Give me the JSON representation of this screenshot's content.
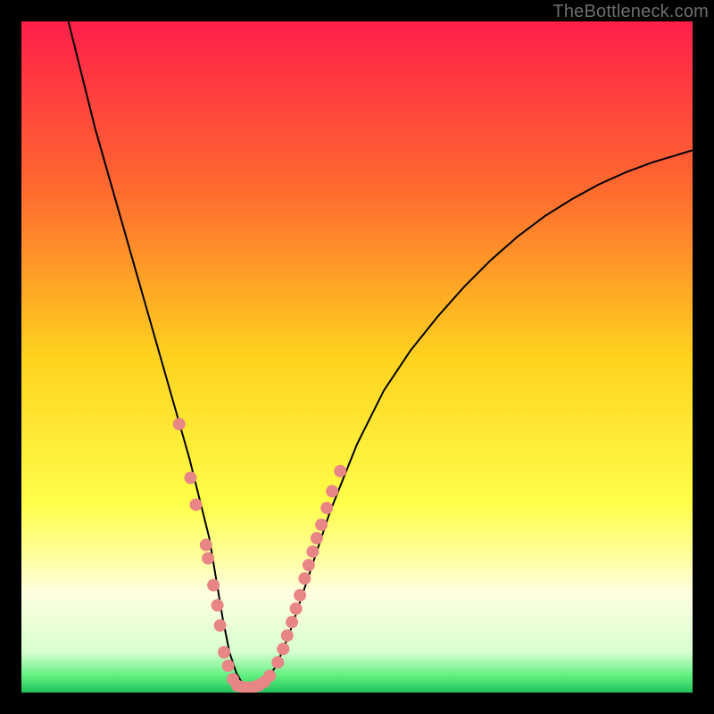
{
  "watermark": "TheBottleneck.com",
  "chart_data": {
    "type": "line",
    "title": "",
    "xlabel": "",
    "ylabel": "",
    "xlim": [
      0,
      100
    ],
    "ylim": [
      0,
      100
    ],
    "grid": false,
    "legend": false,
    "gradient_stops": [
      {
        "offset": 0,
        "color": "#ff1f4a"
      },
      {
        "offset": 0.25,
        "color": "#ff6a2f"
      },
      {
        "offset": 0.5,
        "color": "#ffd21f"
      },
      {
        "offset": 0.72,
        "color": "#ffff4a"
      },
      {
        "offset": 0.8,
        "color": "#ffffa0"
      },
      {
        "offset": 0.85,
        "color": "#ffffe0"
      },
      {
        "offset": 0.94,
        "color": "#d8ffd0"
      },
      {
        "offset": 0.975,
        "color": "#60f080"
      },
      {
        "offset": 1.0,
        "color": "#1fc25a"
      }
    ],
    "series": [
      {
        "name": "bottleneck-curve",
        "x": [
          7,
          9,
          11,
          13,
          15,
          17,
          19,
          21,
          23,
          25,
          26.5,
          28,
          29,
          30,
          31,
          32,
          33,
          34.5,
          36,
          38,
          40,
          42,
          44,
          46,
          48,
          50,
          54,
          58,
          62,
          66,
          70,
          74,
          78,
          82,
          86,
          90,
          94,
          98,
          100
        ],
        "y": [
          100,
          92,
          84,
          77,
          70,
          63,
          56,
          49,
          42,
          35,
          29,
          23,
          17,
          11,
          6,
          3,
          1.2,
          0.7,
          1.3,
          4,
          9,
          15,
          21,
          27,
          32,
          37,
          45,
          51,
          56,
          60.5,
          64.5,
          68,
          71,
          73.5,
          75.7,
          77.5,
          79,
          80.2,
          80.8
        ]
      }
    ],
    "points": {
      "name": "sample-points",
      "color": "#e88686",
      "radius": 7,
      "data": [
        {
          "x": 23.5,
          "y": 40
        },
        {
          "x": 25.2,
          "y": 32
        },
        {
          "x": 26.0,
          "y": 28
        },
        {
          "x": 27.5,
          "y": 22
        },
        {
          "x": 27.8,
          "y": 20
        },
        {
          "x": 28.6,
          "y": 16
        },
        {
          "x": 29.2,
          "y": 13
        },
        {
          "x": 29.6,
          "y": 10
        },
        {
          "x": 30.2,
          "y": 6
        },
        {
          "x": 30.8,
          "y": 4
        },
        {
          "x": 31.5,
          "y": 2
        },
        {
          "x": 32.2,
          "y": 1
        },
        {
          "x": 33.0,
          "y": 0.8
        },
        {
          "x": 33.8,
          "y": 0.7
        },
        {
          "x": 34.6,
          "y": 0.8
        },
        {
          "x": 35.4,
          "y": 1.1
        },
        {
          "x": 36.2,
          "y": 1.6
        },
        {
          "x": 37.0,
          "y": 2.5
        },
        {
          "x": 38.2,
          "y": 4.5
        },
        {
          "x": 39.0,
          "y": 6.5
        },
        {
          "x": 39.6,
          "y": 8.5
        },
        {
          "x": 40.3,
          "y": 10.5
        },
        {
          "x": 40.9,
          "y": 12.5
        },
        {
          "x": 41.5,
          "y": 14.5
        },
        {
          "x": 42.2,
          "y": 17
        },
        {
          "x": 42.8,
          "y": 19
        },
        {
          "x": 43.4,
          "y": 21
        },
        {
          "x": 44.0,
          "y": 23
        },
        {
          "x": 44.7,
          "y": 25
        },
        {
          "x": 45.5,
          "y": 27.5
        },
        {
          "x": 46.3,
          "y": 30
        },
        {
          "x": 47.5,
          "y": 33
        }
      ]
    }
  }
}
